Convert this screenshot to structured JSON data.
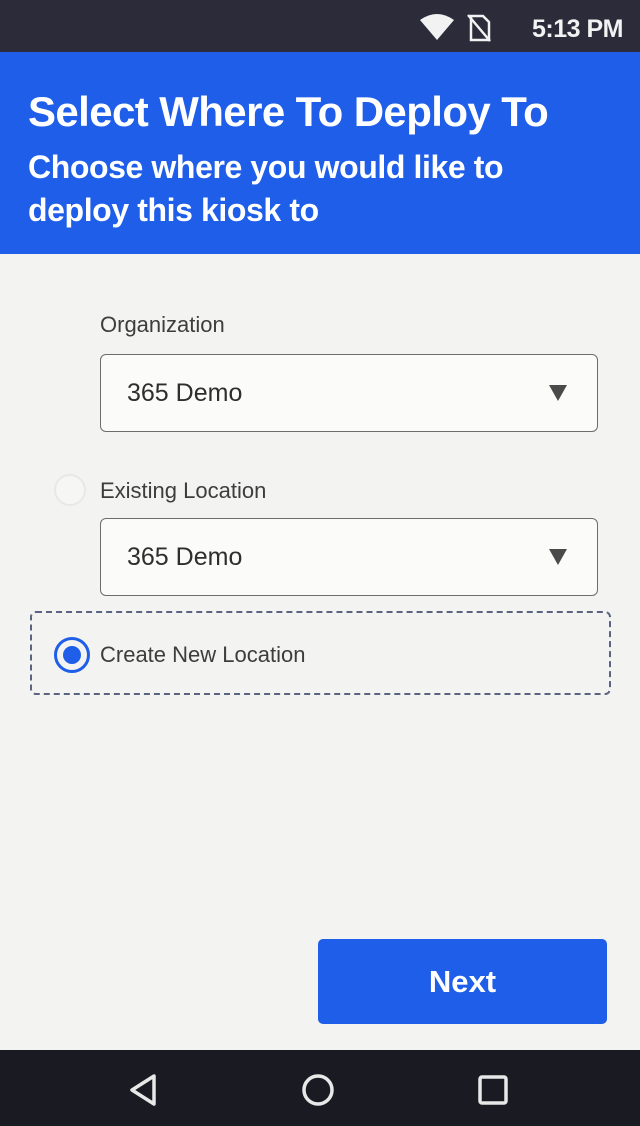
{
  "status_bar": {
    "time": "5:13 PM",
    "icons": [
      "wifi-icon",
      "no-sim-icon"
    ]
  },
  "header": {
    "title": "Select Where To Deploy To",
    "subtitle": "Choose where you would like to deploy this kiosk to"
  },
  "form": {
    "organization": {
      "label": "Organization",
      "selected": "365 Demo"
    },
    "existing_location": {
      "label": "Existing Location",
      "selected": "365 Demo",
      "checked": false
    },
    "create_new_location": {
      "label": "Create New Location",
      "checked": true
    }
  },
  "actions": {
    "next_label": "Next"
  },
  "nav_bar": {
    "icons": [
      "back-icon",
      "home-icon",
      "recents-icon"
    ]
  },
  "colors": {
    "accent": "#1e5ee9",
    "background": "#f3f3f1"
  }
}
